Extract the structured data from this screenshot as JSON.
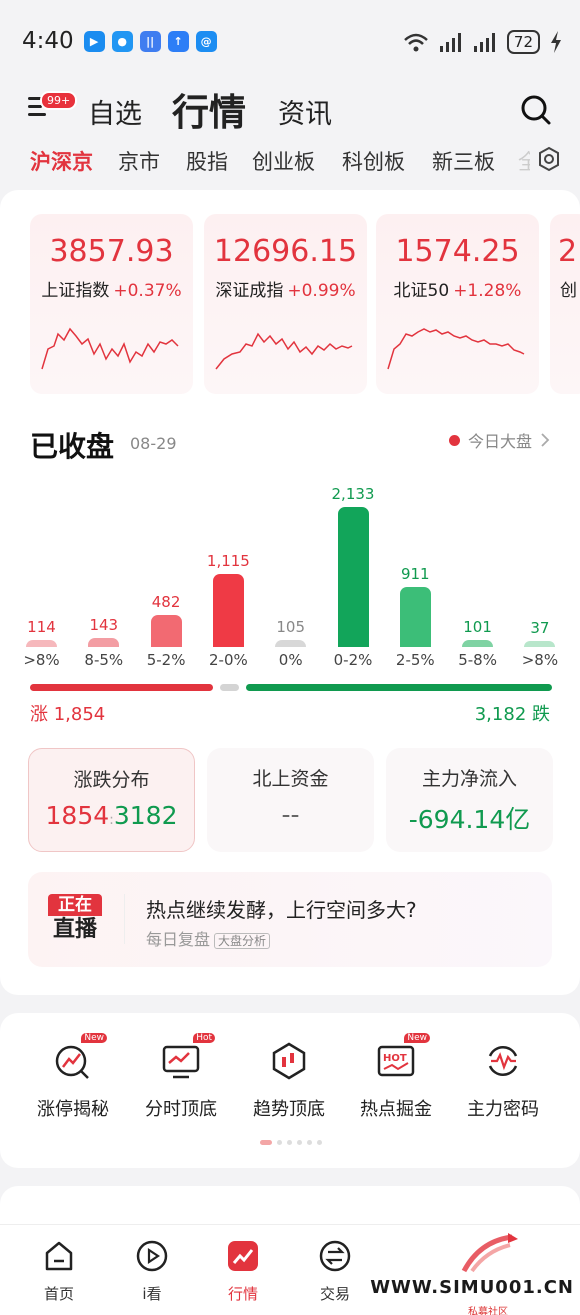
{
  "status_bar": {
    "time": "4:40",
    "battery": "72"
  },
  "header": {
    "menu_badge": "99+",
    "tabs": [
      {
        "label": "自选"
      },
      {
        "label": "行情"
      },
      {
        "label": "资讯"
      }
    ]
  },
  "subtabs": [
    "沪深京",
    "京市",
    "股指",
    "创业板",
    "科创板",
    "新三板",
    "全"
  ],
  "indices": [
    {
      "value": "3857.93",
      "name": "上证指数",
      "change": "+0.37%"
    },
    {
      "value": "12696.15",
      "name": "深证成指",
      "change": "+0.99%"
    },
    {
      "value": "1574.25",
      "name": "北证50",
      "change": "+1.28%"
    },
    {
      "value": "2",
      "name": "创",
      "change": ""
    }
  ],
  "market_status": {
    "title": "已收盘",
    "date": "08-29",
    "link": "今日大盘"
  },
  "chart_data": {
    "type": "bar",
    "categories": [
      ">8%",
      "8-5%",
      "5-2%",
      "2-0%",
      "0%",
      "0-2%",
      "2-5%",
      "5-8%",
      ">8%"
    ],
    "values": [
      114,
      143,
      482,
      1115,
      105,
      2133,
      911,
      101,
      37
    ],
    "value_labels": [
      "114",
      "143",
      "482",
      "1,115",
      "105",
      "2,133",
      "911",
      "101",
      "37"
    ],
    "colors": [
      "#f6b8bc",
      "#f39da3",
      "#f26a72",
      "#ef3a45",
      "#d8d8d8",
      "#12a55a",
      "#3cbe78",
      "#7fd3a3",
      "#b8e6cb"
    ],
    "label_colors": [
      "#e2343e",
      "#e2343e",
      "#e2343e",
      "#e2343e",
      "#888888",
      "#109a4f",
      "#109a4f",
      "#109a4f",
      "#109a4f"
    ],
    "title": "",
    "xlabel": "",
    "ylabel": ""
  },
  "totals": {
    "up": "涨 1,854",
    "down": "3,182 跌"
  },
  "stats": [
    {
      "title": "涨跌分布",
      "up": "1854",
      "sep": ":",
      "down": "3182"
    },
    {
      "title": "北上资金",
      "value": "--"
    },
    {
      "title": "主力净流入",
      "value": "-694.14亿"
    }
  ],
  "live": {
    "badge_top": "正在",
    "badge_bottom": "直播",
    "title": "热点继续发酵，上行空间多大?",
    "subtitle": "每日复盘",
    "tag": "大盘分析"
  },
  "tools": [
    {
      "label": "涨停揭秘",
      "badge": "New",
      "icon": "limit-up-icon"
    },
    {
      "label": "分时顶底",
      "badge": "Hot",
      "icon": "intraday-icon"
    },
    {
      "label": "趋势顶底",
      "badge": "",
      "icon": "trend-icon"
    },
    {
      "label": "热点掘金",
      "badge": "New",
      "icon": "hotspot-icon"
    },
    {
      "label": "主力密码",
      "badge": "",
      "icon": "main-force-icon"
    }
  ],
  "bottom_nav": [
    {
      "label": "首页",
      "icon": "home-icon"
    },
    {
      "label": "i看",
      "icon": "play-icon"
    },
    {
      "label": "行情",
      "icon": "market-icon"
    },
    {
      "label": "交易",
      "icon": "trade-icon"
    }
  ],
  "watermark": {
    "text": "WWW.SIMU001.CN",
    "sub": "私募社区"
  },
  "colors": {
    "up": "#e2343e",
    "down": "#109a4f",
    "accent": "#e2343e"
  }
}
